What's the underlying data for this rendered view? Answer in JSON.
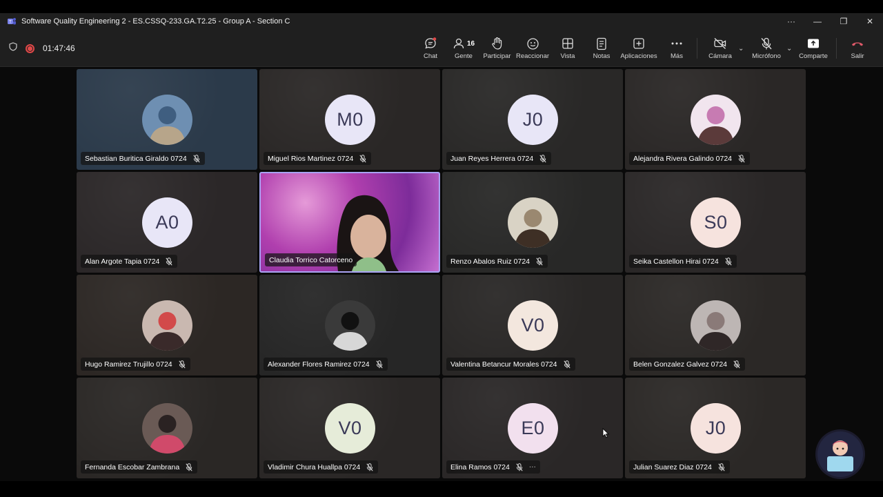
{
  "window": {
    "title": "Software Quality Engineering 2 - ES.CSSQ-233.GA.T2.25 - Group A - Section C",
    "more": "···",
    "minimize": "—",
    "restore": "❐",
    "close": "✕"
  },
  "meeting": {
    "timer": "01:47:46"
  },
  "toolbar": {
    "chat": "Chat",
    "people": "Gente",
    "people_count": "16",
    "raise": "Participar",
    "react": "Reaccionar",
    "view": "Vista",
    "notes": "Notas",
    "apps": "Aplicaciones",
    "more": "Más",
    "camera": "Cámara",
    "mic": "Micrófono",
    "share": "Comparte",
    "leave": "Salir"
  },
  "participants": [
    {
      "name": "Sebastian Buritica Giraldo 0724",
      "initials": "",
      "type": "photo",
      "bg": "#2b3a4a"
    },
    {
      "name": "Miguel Rios Martinez 0724",
      "initials": "M0",
      "type": "initials",
      "avatar_color": "#e8e6f7",
      "bg": "#2a2726"
    },
    {
      "name": "Juan Reyes Herrera 0724",
      "initials": "J0",
      "type": "initials",
      "avatar_color": "#e8e6f7",
      "bg": "#292827"
    },
    {
      "name": "Alejandra Rivera Galindo 0724",
      "initials": "",
      "type": "photo",
      "bg": "#2a2726"
    },
    {
      "name": "Alan Argote Tapia 0724",
      "initials": "A0",
      "type": "initials",
      "avatar_color": "#e8e6f7",
      "bg": "#2b2728"
    },
    {
      "name": "Claudia Torrico Catorceno",
      "initials": "",
      "type": "video",
      "bg": "#b03fae"
    },
    {
      "name": "Renzo Abalos Ruiz 0724",
      "initials": "",
      "type": "photo",
      "bg": "#282827"
    },
    {
      "name": "Seika Castellon Hirai 0724",
      "initials": "S0",
      "type": "initials",
      "avatar_color": "#f6e3de",
      "bg": "#2a2727"
    },
    {
      "name": "Hugo Ramirez Trujillo 0724",
      "initials": "",
      "type": "photo",
      "bg": "#2c2724"
    },
    {
      "name": "Alexander Flores Ramirez 0724",
      "initials": "",
      "type": "photo",
      "bg": "#262626"
    },
    {
      "name": "Valentina Betancur Morales 0724",
      "initials": "V0",
      "type": "initials",
      "avatar_color": "#f3e7de",
      "bg": "#292726"
    },
    {
      "name": "Belen Gonzalez Galvez 0724",
      "initials": "",
      "type": "photo",
      "bg": "#2b2826"
    },
    {
      "name": "Fernanda Escobar Zambrana",
      "initials": "",
      "type": "photo",
      "bg": "#2a2725"
    },
    {
      "name": "Vladimir Chura Huallpa 0724",
      "initials": "V0",
      "type": "initials",
      "avatar_color": "#e6ecd9",
      "bg": "#2a2726"
    },
    {
      "name": "Elina Ramos 0724",
      "initials": "E0",
      "type": "initials",
      "avatar_color": "#f2e0ee",
      "bg": "#2a2727",
      "has_more": true
    },
    {
      "name": "Julian Suarez Diaz 0724",
      "initials": "J0",
      "type": "initials",
      "avatar_color": "#f6e3de",
      "bg": "#2b2826"
    }
  ],
  "colors": {
    "accent": "#a9a3f3",
    "leave": "#e05a6a",
    "recording": "#e04848",
    "initials_text": "#3b3a58"
  }
}
